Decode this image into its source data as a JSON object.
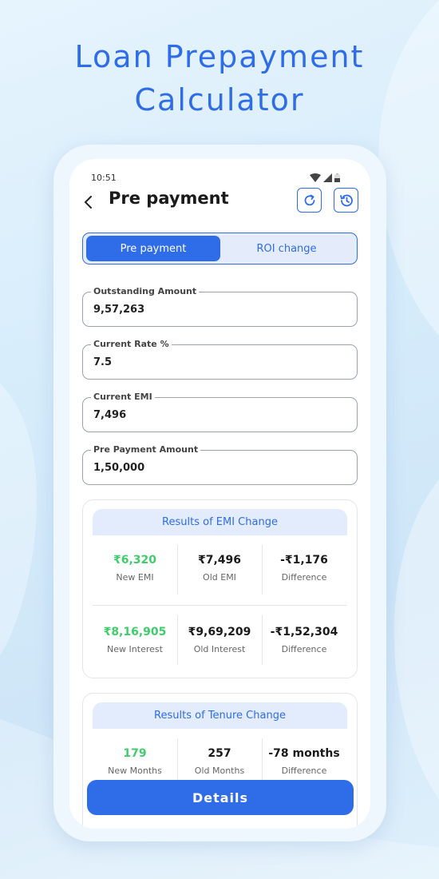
{
  "headline": {
    "line1": "Loan Prepayment",
    "line2": "Calculator"
  },
  "status": {
    "time": "10:51"
  },
  "header": {
    "title": "Pre payment"
  },
  "segment": {
    "tab_prepayment": "Pre payment",
    "tab_roi": "ROI change"
  },
  "fields": {
    "outstanding": {
      "label": "Outstanding Amount",
      "value": "9,57,263"
    },
    "rate": {
      "label": "Current Rate %",
      "value": "7.5"
    },
    "emi": {
      "label": "Current EMI",
      "value": "7,496"
    },
    "prepay": {
      "label": "Pre Payment Amount",
      "value": "1,50,000"
    }
  },
  "emi_results": {
    "title": "Results of EMI Change",
    "row1": [
      {
        "value": "₹6,320",
        "label": "New EMI"
      },
      {
        "value": "₹7,496",
        "label": "Old EMI"
      },
      {
        "value": "-₹1,176",
        "label": "Difference"
      }
    ],
    "row2": [
      {
        "value": "₹8,16,905",
        "label": "New Interest"
      },
      {
        "value": "₹9,69,209",
        "label": "Old Interest"
      },
      {
        "value": "-₹1,52,304",
        "label": "Difference"
      }
    ]
  },
  "tenure_results": {
    "title": "Results of Tenure Change",
    "row1": [
      {
        "value": "179",
        "label": "New Months"
      },
      {
        "value": "257",
        "label": "Old Months"
      },
      {
        "value": "-78 months",
        "label": "Difference"
      }
    ]
  },
  "actions": {
    "details_label": "Details"
  },
  "icons": {
    "back": "chevron-left-icon",
    "refresh": "refresh-icon",
    "history": "history-icon",
    "wifi": "wifi-icon",
    "signal": "signal-icon",
    "battery": "battery-icon"
  },
  "colors": {
    "accent": "#2f6ce8",
    "positive": "#3fcd6b",
    "text": "#1a1a1a"
  }
}
